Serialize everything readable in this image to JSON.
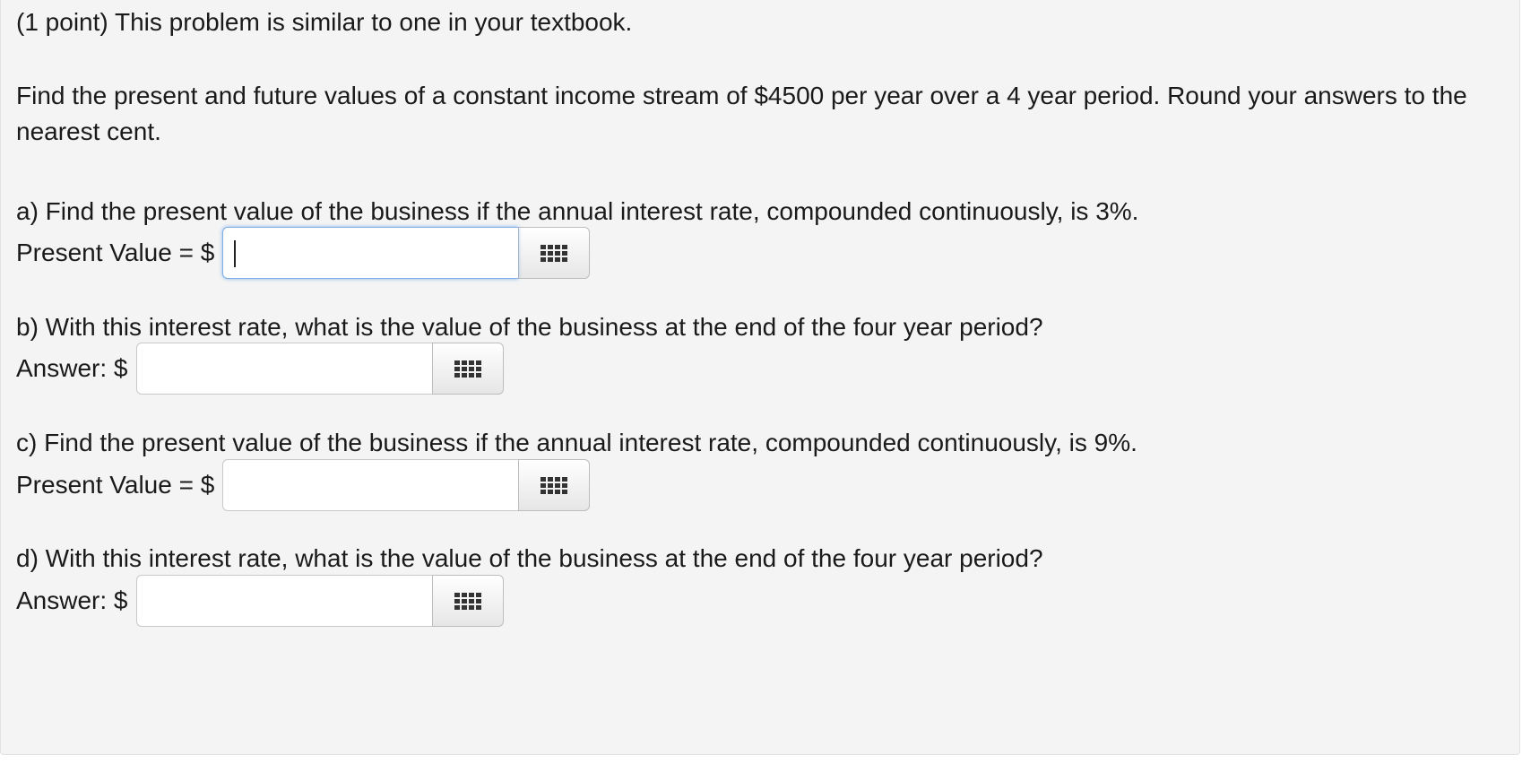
{
  "problem": {
    "header": "(1 point) This problem is similar to one in your textbook.",
    "intro": "Find the present and future values of a constant income stream of $4500 per year over a 4 year period. Round your answers to the nearest cent.",
    "parts": [
      {
        "question": "a) Find the present value of the business if the annual interest rate, compounded continuously, is 3%.",
        "label": "Present Value = $",
        "value": "",
        "focused": true,
        "tool_icon": "grid-icon"
      },
      {
        "question": "b) With this interest rate, what is the value of the business at the end of the four year period?",
        "label": "Answer: $",
        "value": "",
        "focused": false,
        "tool_icon": "grid-icon"
      },
      {
        "question": "c) Find the present value of the business if the annual interest rate, compounded continuously, is 9%.",
        "label": "Present Value = $",
        "value": "",
        "focused": false,
        "tool_icon": "grid-icon"
      },
      {
        "question": "d) With this interest rate, what is the value of the business at the end of the four year period?",
        "label": "Answer: $",
        "value": "",
        "focused": false,
        "tool_icon": "grid-icon"
      }
    ]
  },
  "colors": {
    "panel_background": "#f4f4f4",
    "focus_border": "#7eb0e6"
  }
}
